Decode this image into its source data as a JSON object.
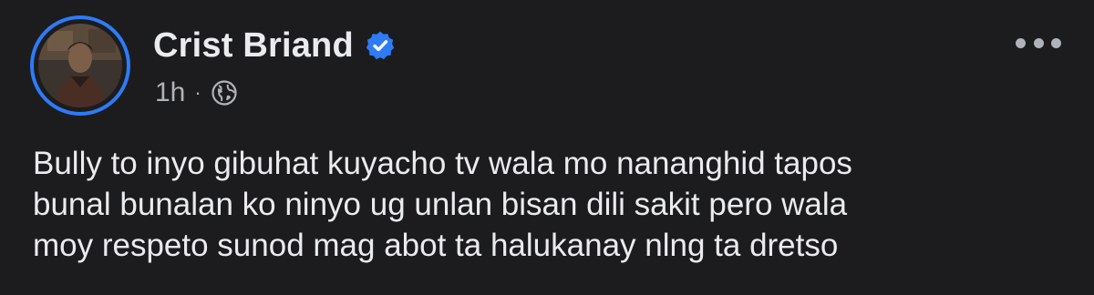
{
  "post": {
    "author": {
      "name": "Crist Briand",
      "verified_icon": "verified-badge-icon",
      "avatar_ring_color": "#2e7bf6"
    },
    "timestamp": "1h",
    "separator": "·",
    "audience_icon": "globe-icon",
    "more_icon": "more-options-icon",
    "text": "Bully to inyo gibuhat kuyacho tv wala mo nananghid tapos\nbunal bunalan ko ninyo ug unlan bisan dili sakit pero wala\nmoy respeto sunod mag abot ta halukanay nlng ta dretso"
  },
  "colors": {
    "background": "#1c1c1e",
    "text_primary": "#e9ebee",
    "text_secondary": "#b0b3b8",
    "verified_blue": "#2e7bf6"
  }
}
